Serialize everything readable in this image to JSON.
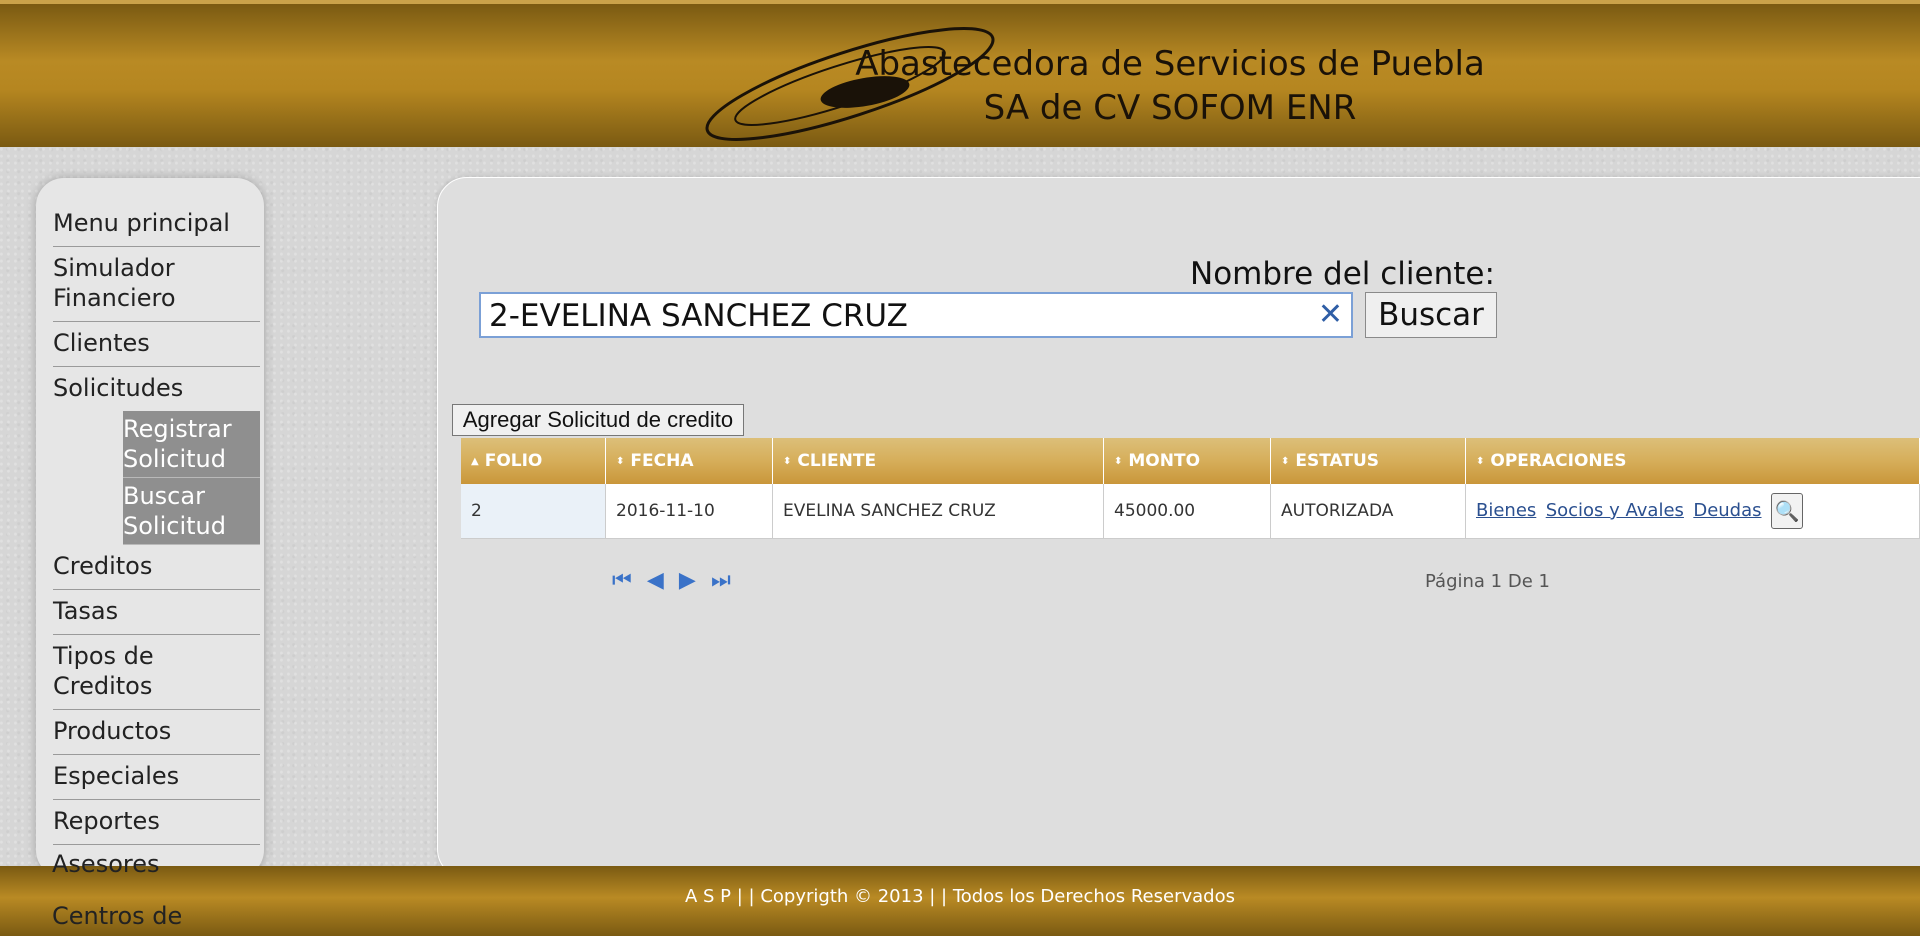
{
  "header": {
    "company_line1": "Abastecedora de Servicios de Puebla",
    "company_line2": "SA de CV SOFOM ENR"
  },
  "sidebar": {
    "items": [
      {
        "label": "Menu principal"
      },
      {
        "label": "Simulador Financiero"
      },
      {
        "label": "Clientes"
      },
      {
        "label": "Solicitudes"
      },
      {
        "label": "Creditos"
      },
      {
        "label": "Tasas"
      },
      {
        "label": "Tipos de Creditos"
      },
      {
        "label": "Productos"
      },
      {
        "label": "Especiales"
      },
      {
        "label": "Reportes"
      }
    ],
    "sub_items": [
      {
        "label": "Registrar Solicitud"
      },
      {
        "label": "Buscar Solicitud"
      }
    ],
    "partial_items": [
      {
        "label": "Asesores"
      },
      {
        "label": "Centros de"
      }
    ]
  },
  "search": {
    "label": "Nombre del cliente:",
    "value": "2-EVELINA SANCHEZ CRUZ",
    "clear_icon": "✕",
    "button": "Buscar"
  },
  "actions": {
    "add_button": "Agregar Solicitud de credito"
  },
  "table": {
    "columns": [
      "FOLIO",
      "FECHA",
      "CLIENTE",
      "MONTO",
      "ESTATUS",
      "OPERACIONES"
    ],
    "rows": [
      {
        "folio": "2",
        "fecha": "2016-11-10",
        "cliente": "EVELINA SANCHEZ CRUZ",
        "monto": "45000.00",
        "estatus": "AUTORIZADA",
        "ops": [
          "Bienes",
          "Socios y Avales",
          "Deudas"
        ]
      }
    ]
  },
  "pager": {
    "first_icon": "first-page-icon",
    "prev_icon": "prev-page-icon",
    "next_icon": "next-page-icon",
    "last_icon": "last-page-icon",
    "info": "Página 1 De 1"
  },
  "footer": {
    "text": "A S P | | Copyrigth © 2013 | | Todos los Derechos Reservados"
  },
  "colors": {
    "header_gold": "#b98a24",
    "table_header": "#d6ae5a",
    "link_blue": "#2a4f8f"
  }
}
